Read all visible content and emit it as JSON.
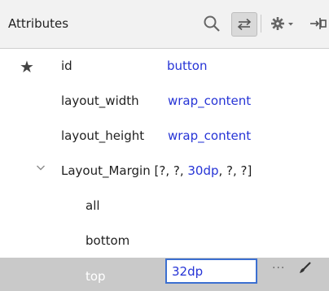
{
  "header": {
    "title": "Attributes",
    "icons": {
      "search": "search-icon",
      "swap": "swap-arrows-icon",
      "gear": "gear-dropdown-icon",
      "pin": "pin-icon"
    }
  },
  "rows": {
    "id": {
      "name": "id",
      "value": "button",
      "starred": true
    },
    "layout_width": {
      "name": "layout_width",
      "value": "wrap_content"
    },
    "layout_height": {
      "name": "layout_height",
      "value": "wrap_content"
    },
    "layout_margin": {
      "name": "Layout_Margin",
      "values_prefix": "[?, ?, ",
      "values_highlight": "30dp",
      "values_suffix": ", ?, ?]",
      "expanded": true
    },
    "all": {
      "name": "all"
    },
    "bottom": {
      "name": "bottom"
    },
    "top": {
      "name": "top",
      "value": "32dp",
      "selected": true,
      "more": "···"
    }
  },
  "colors": {
    "value_blue": "#2634d6",
    "selected_row": "#c9c9c9",
    "focus_border": "#3b6fd1"
  }
}
